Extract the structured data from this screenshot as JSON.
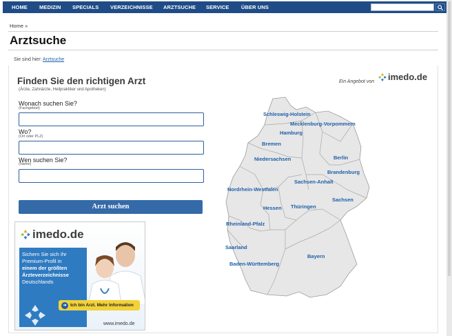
{
  "nav": {
    "items": [
      "HOME",
      "MEDIZIN",
      "SPECIALS",
      "VERZEICHNISSE",
      "ARZTSUCHE",
      "SERVICE",
      "ÜBER UNS"
    ],
    "search_value": ""
  },
  "breadcrumb": {
    "home": "Home",
    "separator": "»"
  },
  "page_title": "Arztsuche",
  "location": {
    "prefix": "Sie sind hier:",
    "link": "Arztsuche"
  },
  "finder": {
    "heading": "Finden Sie den richtigen Arzt",
    "subheading": "(Ärzte, Zahnärzte, Heilpraktiker und Apotheken)",
    "offer_text": "Ein Angebot von",
    "brand": "imedo.de",
    "fields": [
      {
        "label": "Wonach suchen Sie?",
        "hint": "(Fachgebiet)",
        "value": ""
      },
      {
        "label": "Wo?",
        "hint": "(Ort oder PLZ)",
        "value": ""
      },
      {
        "label": "Wen suchen Sie?",
        "hint": "(Name)",
        "value": ""
      }
    ],
    "submit_label": "Arzt suchen"
  },
  "ad": {
    "brand": "imedo.de",
    "line1": "Sichern Sie sich Ihr",
    "line2": "Premium-Profil in",
    "line3": "einem der größten",
    "line4": "Ärzteverzeichnisse",
    "line5": "Deutschlands",
    "cta": "Ich bin Arzt. Mehr Information",
    "url": "www.imedo.de"
  },
  "map": {
    "states": [
      "Schleswig-Holstein",
      "Mecklenburg-Vorpommern",
      "Hamburg",
      "Bremen",
      "Niedersachsen",
      "Berlin",
      "Brandenburg",
      "Sachsen-Anhalt",
      "Nordrhein-Westfalen",
      "Sachsen",
      "Hessen",
      "Thüringen",
      "Rheinland-Pfalz",
      "Saarland",
      "Bayern",
      "Baden-Württemberg"
    ]
  },
  "colors": {
    "nav_bg": "#1f4c87",
    "accent": "#356aa8",
    "link": "#1f5fa8",
    "cta": "#f2d23a"
  }
}
